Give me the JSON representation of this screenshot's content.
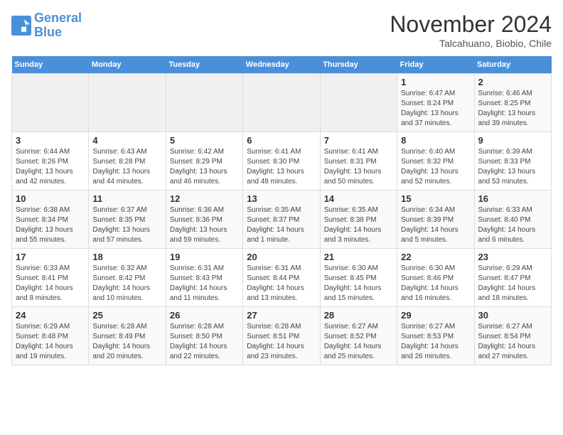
{
  "logo": {
    "line1": "General",
    "line2": "Blue"
  },
  "title": "November 2024",
  "subtitle": "Talcahuano, Biobio, Chile",
  "weekdays": [
    "Sunday",
    "Monday",
    "Tuesday",
    "Wednesday",
    "Thursday",
    "Friday",
    "Saturday"
  ],
  "weeks": [
    [
      {
        "day": "",
        "detail": ""
      },
      {
        "day": "",
        "detail": ""
      },
      {
        "day": "",
        "detail": ""
      },
      {
        "day": "",
        "detail": ""
      },
      {
        "day": "",
        "detail": ""
      },
      {
        "day": "1",
        "detail": "Sunrise: 6:47 AM\nSunset: 8:24 PM\nDaylight: 13 hours\nand 37 minutes."
      },
      {
        "day": "2",
        "detail": "Sunrise: 6:46 AM\nSunset: 8:25 PM\nDaylight: 13 hours\nand 39 minutes."
      }
    ],
    [
      {
        "day": "3",
        "detail": "Sunrise: 6:44 AM\nSunset: 8:26 PM\nDaylight: 13 hours\nand 42 minutes."
      },
      {
        "day": "4",
        "detail": "Sunrise: 6:43 AM\nSunset: 8:28 PM\nDaylight: 13 hours\nand 44 minutes."
      },
      {
        "day": "5",
        "detail": "Sunrise: 6:42 AM\nSunset: 8:29 PM\nDaylight: 13 hours\nand 46 minutes."
      },
      {
        "day": "6",
        "detail": "Sunrise: 6:41 AM\nSunset: 8:30 PM\nDaylight: 13 hours\nand 48 minutes."
      },
      {
        "day": "7",
        "detail": "Sunrise: 6:41 AM\nSunset: 8:31 PM\nDaylight: 13 hours\nand 50 minutes."
      },
      {
        "day": "8",
        "detail": "Sunrise: 6:40 AM\nSunset: 8:32 PM\nDaylight: 13 hours\nand 52 minutes."
      },
      {
        "day": "9",
        "detail": "Sunrise: 6:39 AM\nSunset: 8:33 PM\nDaylight: 13 hours\nand 53 minutes."
      }
    ],
    [
      {
        "day": "10",
        "detail": "Sunrise: 6:38 AM\nSunset: 8:34 PM\nDaylight: 13 hours\nand 55 minutes."
      },
      {
        "day": "11",
        "detail": "Sunrise: 6:37 AM\nSunset: 8:35 PM\nDaylight: 13 hours\nand 57 minutes."
      },
      {
        "day": "12",
        "detail": "Sunrise: 6:36 AM\nSunset: 8:36 PM\nDaylight: 13 hours\nand 59 minutes."
      },
      {
        "day": "13",
        "detail": "Sunrise: 6:35 AM\nSunset: 8:37 PM\nDaylight: 14 hours\nand 1 minute."
      },
      {
        "day": "14",
        "detail": "Sunrise: 6:35 AM\nSunset: 8:38 PM\nDaylight: 14 hours\nand 3 minutes."
      },
      {
        "day": "15",
        "detail": "Sunrise: 6:34 AM\nSunset: 8:39 PM\nDaylight: 14 hours\nand 5 minutes."
      },
      {
        "day": "16",
        "detail": "Sunrise: 6:33 AM\nSunset: 8:40 PM\nDaylight: 14 hours\nand 6 minutes."
      }
    ],
    [
      {
        "day": "17",
        "detail": "Sunrise: 6:33 AM\nSunset: 8:41 PM\nDaylight: 14 hours\nand 8 minutes."
      },
      {
        "day": "18",
        "detail": "Sunrise: 6:32 AM\nSunset: 8:42 PM\nDaylight: 14 hours\nand 10 minutes."
      },
      {
        "day": "19",
        "detail": "Sunrise: 6:31 AM\nSunset: 8:43 PM\nDaylight: 14 hours\nand 11 minutes."
      },
      {
        "day": "20",
        "detail": "Sunrise: 6:31 AM\nSunset: 8:44 PM\nDaylight: 14 hours\nand 13 minutes."
      },
      {
        "day": "21",
        "detail": "Sunrise: 6:30 AM\nSunset: 8:45 PM\nDaylight: 14 hours\nand 15 minutes."
      },
      {
        "day": "22",
        "detail": "Sunrise: 6:30 AM\nSunset: 8:46 PM\nDaylight: 14 hours\nand 16 minutes."
      },
      {
        "day": "23",
        "detail": "Sunrise: 6:29 AM\nSunset: 8:47 PM\nDaylight: 14 hours\nand 18 minutes."
      }
    ],
    [
      {
        "day": "24",
        "detail": "Sunrise: 6:29 AM\nSunset: 8:48 PM\nDaylight: 14 hours\nand 19 minutes."
      },
      {
        "day": "25",
        "detail": "Sunrise: 6:28 AM\nSunset: 8:49 PM\nDaylight: 14 hours\nand 20 minutes."
      },
      {
        "day": "26",
        "detail": "Sunrise: 6:28 AM\nSunset: 8:50 PM\nDaylight: 14 hours\nand 22 minutes."
      },
      {
        "day": "27",
        "detail": "Sunrise: 6:28 AM\nSunset: 8:51 PM\nDaylight: 14 hours\nand 23 minutes."
      },
      {
        "day": "28",
        "detail": "Sunrise: 6:27 AM\nSunset: 8:52 PM\nDaylight: 14 hours\nand 25 minutes."
      },
      {
        "day": "29",
        "detail": "Sunrise: 6:27 AM\nSunset: 8:53 PM\nDaylight: 14 hours\nand 26 minutes."
      },
      {
        "day": "30",
        "detail": "Sunrise: 6:27 AM\nSunset: 8:54 PM\nDaylight: 14 hours\nand 27 minutes."
      }
    ]
  ]
}
